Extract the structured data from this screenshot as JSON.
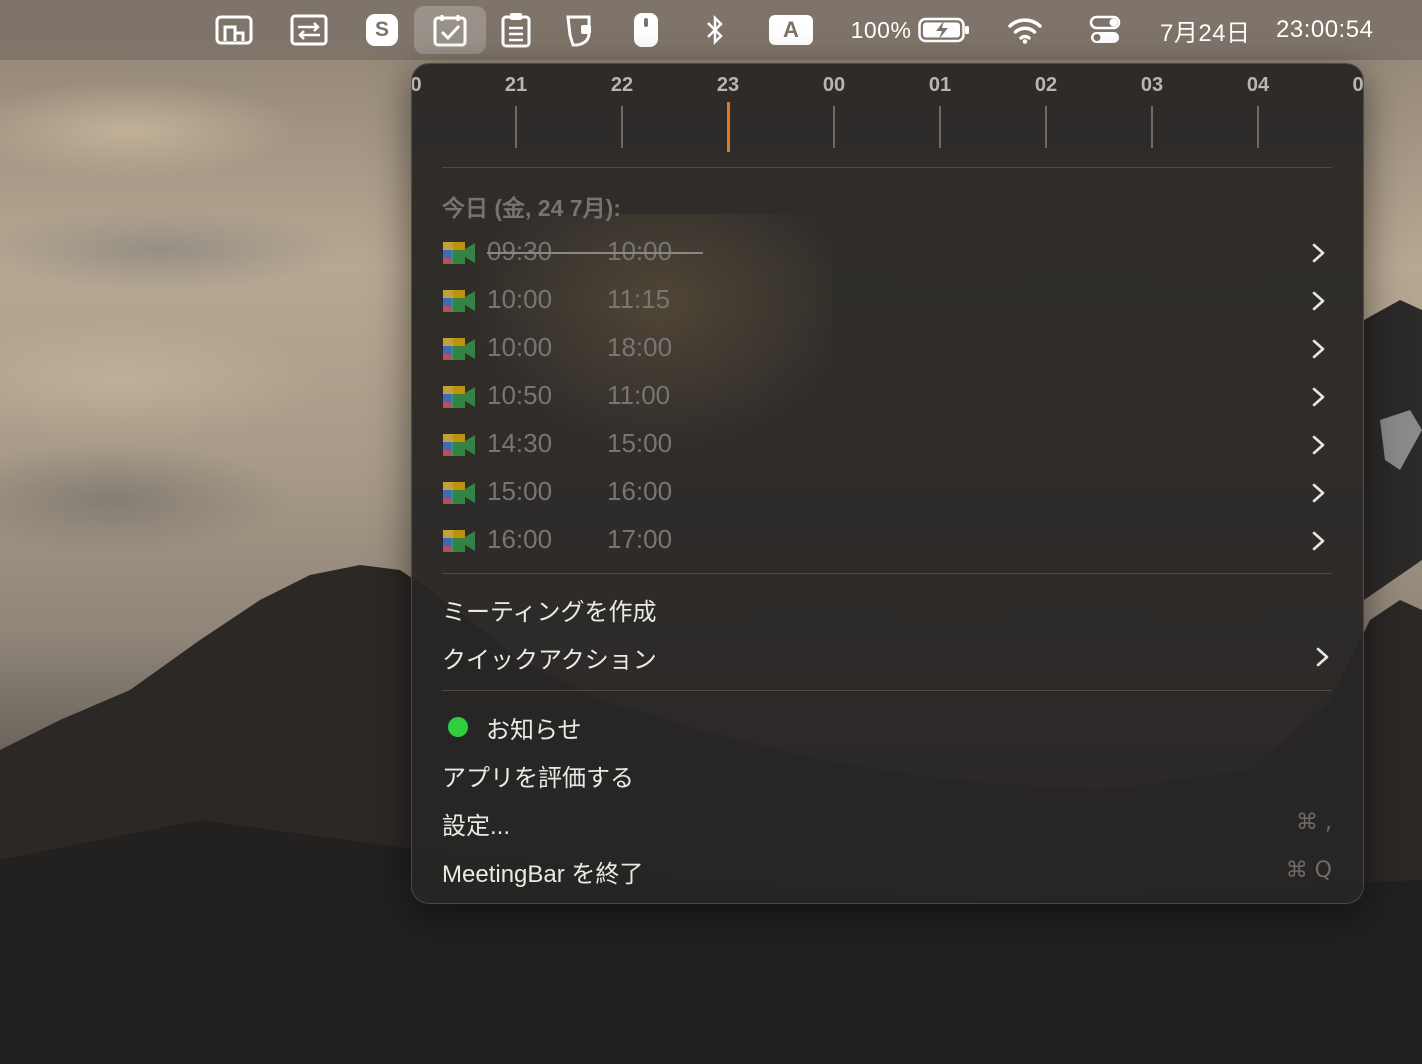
{
  "menubar": {
    "battery_percent": "100%",
    "date": "7月24日",
    "time": "23:00:54",
    "input_source_label": "A",
    "skype_label": "S",
    "icons": [
      "screen-share-icon",
      "remote-desktop-icon",
      "skype-icon",
      "meetingbar-icon",
      "clipboard-icon",
      "bottle-icon",
      "mouse-icon",
      "bluetooth-icon",
      "input-source-icon",
      "battery-icon",
      "wifi-icon",
      "control-center-icon"
    ]
  },
  "timeline": {
    "hours": [
      "0",
      "21",
      "22",
      "23",
      "00",
      "01",
      "02",
      "03",
      "04",
      "0"
    ],
    "current_hour": "23",
    "now_color": "#e07a1e"
  },
  "today": {
    "heading": "今日 (金, 24 7月):",
    "events": [
      {
        "start": "09:30",
        "end": "10:00",
        "past": true
      },
      {
        "start": "10:00",
        "end": "11:15",
        "past": false
      },
      {
        "start": "10:00",
        "end": "18:00",
        "past": false
      },
      {
        "start": "10:50",
        "end": "11:00",
        "past": false
      },
      {
        "start": "14:30",
        "end": "15:00",
        "past": false
      },
      {
        "start": "15:00",
        "end": "16:00",
        "past": false
      },
      {
        "start": "16:00",
        "end": "17:00",
        "past": false
      }
    ]
  },
  "actions": {
    "create_meeting": "ミーティングを作成",
    "quick_actions": "クイックアクション"
  },
  "footer": {
    "notifications": "お知らせ",
    "notifications_status_color": "#2fcf3e",
    "rate_app": "アプリを評価する",
    "preferences": "設定...",
    "preferences_shortcut": "⌘ ,",
    "quit": "MeetingBar を終了",
    "quit_shortcut": "⌘ Q"
  }
}
